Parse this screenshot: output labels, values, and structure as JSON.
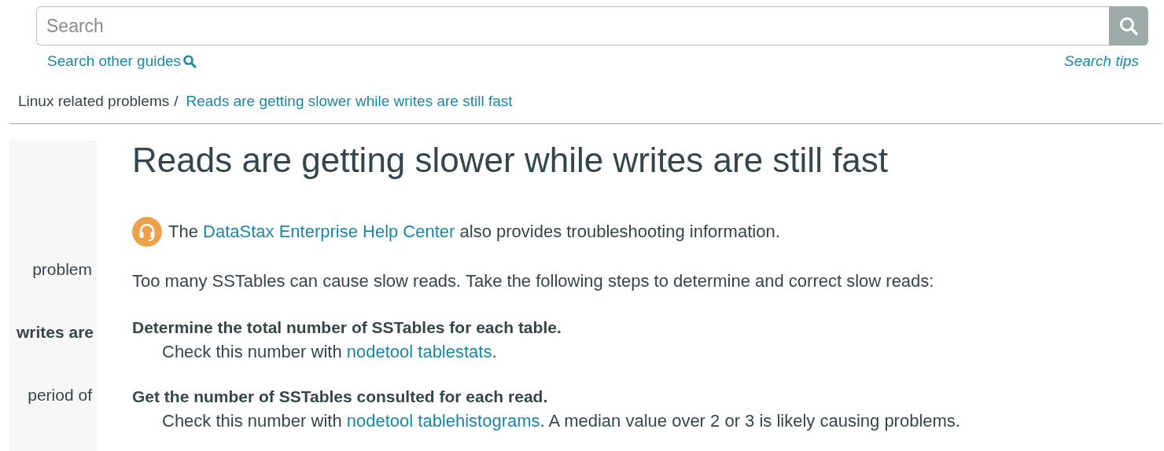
{
  "search": {
    "placeholder": "Search",
    "other_guides_link": "Search other guides",
    "tips_link": "Search tips"
  },
  "breadcrumb": [
    {
      "label": "Linux related problems",
      "kind": "text"
    },
    {
      "label": "/",
      "kind": "separator"
    },
    {
      "label": "Reads are getting slower while writes are still fast",
      "kind": "link"
    }
  ],
  "sidebar": {
    "items": [
      {
        "label": "problem",
        "selected": false
      },
      {
        "label": "writes are",
        "selected": true
      },
      {
        "label": "period of",
        "selected": false
      }
    ]
  },
  "title": "Reads are getting slower while writes are still fast",
  "note": {
    "before": "The ",
    "link": "DataStax Enterprise Help Center",
    "after": " also provides troubleshooting information."
  },
  "intro": "Too many SSTables can cause slow reads. Take the following steps to determine and correct slow reads:",
  "steps": [
    {
      "heading": "Determine the total number of SSTables for each table.",
      "before": "Check this number with ",
      "link": "nodetool tablestats",
      "after": "."
    },
    {
      "heading": "Get the number of SSTables consulted for each read.",
      "before": "Check this number with ",
      "link": "nodetool tablehistograms",
      "after": ". A median value over 2 or 3 is likely causing problems."
    }
  ]
}
